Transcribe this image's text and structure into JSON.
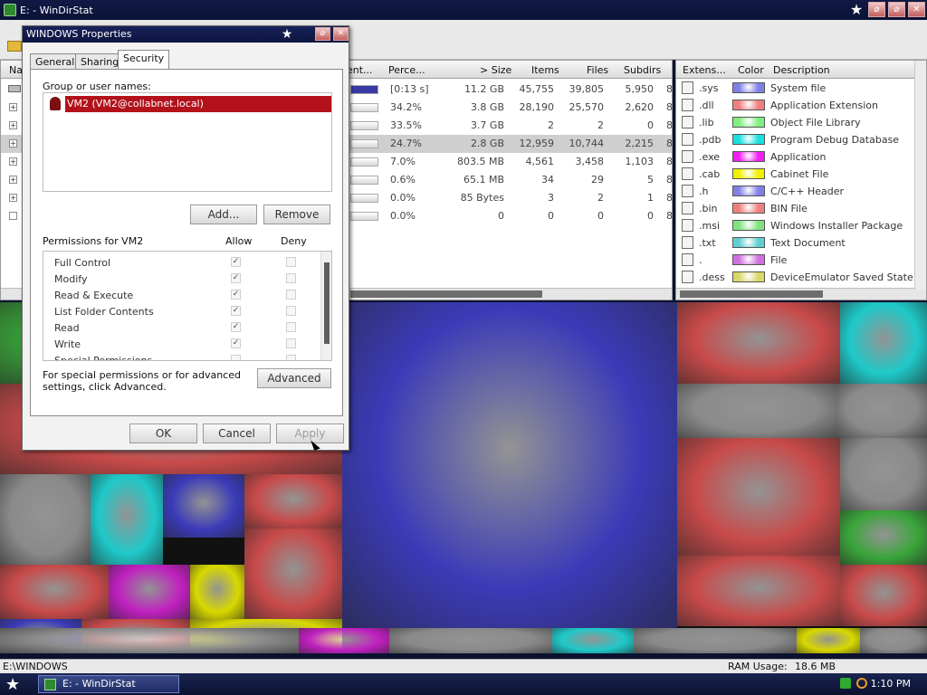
{
  "window": {
    "title": "E: - WinDirStat"
  },
  "list": {
    "headers": {
      "name": "Na",
      "subtree": "ent...",
      "percent": "Perce...",
      "size": "> Size",
      "items": "Items",
      "files": "Files",
      "subdirs": "Subdirs"
    },
    "rows": [
      {
        "percent": "[0:13 s]",
        "size": "11.2 GB",
        "items": "45,755",
        "files": "39,805",
        "subdirs": "5,950",
        "fill": 1.0,
        "expander": ""
      },
      {
        "percent": "34.2%",
        "size": "3.8 GB",
        "items": "28,190",
        "files": "25,570",
        "subdirs": "2,620",
        "fill": 0.0,
        "expander": "+"
      },
      {
        "percent": "33.5%",
        "size": "3.7 GB",
        "items": "2",
        "files": "2",
        "subdirs": "0",
        "fill": 0.0,
        "expander": "+"
      },
      {
        "percent": "24.7%",
        "size": "2.8 GB",
        "items": "12,959",
        "files": "10,744",
        "subdirs": "2,215",
        "fill": 0.0,
        "expander": "+"
      },
      {
        "percent": "7.0%",
        "size": "803.5 MB",
        "items": "4,561",
        "files": "3,458",
        "subdirs": "1,103",
        "fill": 0.0,
        "expander": "+"
      },
      {
        "percent": "0.6%",
        "size": "65.1 MB",
        "items": "34",
        "files": "29",
        "subdirs": "5",
        "fill": 0.0,
        "expander": "+"
      },
      {
        "percent": "0.0%",
        "size": "85 Bytes",
        "items": "3",
        "files": "2",
        "subdirs": "1",
        "fill": 0.0,
        "expander": "+"
      },
      {
        "percent": "0.0%",
        "size": "0",
        "items": "0",
        "files": "0",
        "subdirs": "0",
        "fill": 0.0,
        "expander": ""
      }
    ],
    "trailing_digit": "8",
    "selected_row_index": 3
  },
  "extensions": {
    "headers": {
      "ext": "Extens...",
      "color": "Color",
      "desc": "Description"
    },
    "rows": [
      {
        "ext": ".sys",
        "color": "#7f7fe6",
        "desc": "System file"
      },
      {
        "ext": ".dll",
        "color": "#ef7f7f",
        "desc": "Application Extension"
      },
      {
        "ext": ".lib",
        "color": "#7fef7f",
        "desc": "Object File Library"
      },
      {
        "ext": ".pdb",
        "color": "#19e0e0",
        "desc": "Program Debug Database"
      },
      {
        "ext": ".exe",
        "color": "#f01ff0",
        "desc": "Application"
      },
      {
        "ext": ".cab",
        "color": "#f0f000",
        "desc": "Cabinet File"
      },
      {
        "ext": ".h",
        "color": "#8080e6",
        "desc": "C/C++ Header"
      },
      {
        "ext": ".bin",
        "color": "#ef7f7f",
        "desc": "BIN File"
      },
      {
        "ext": ".msi",
        "color": "#7fe27f",
        "desc": "Windows Installer Package"
      },
      {
        "ext": ".txt",
        "color": "#5fcfcf",
        "desc": "Text Document"
      },
      {
        "ext": ".",
        "color": "#d070e0",
        "desc": "File"
      },
      {
        "ext": ".dess",
        "color": "#d8d86a",
        "desc": "DeviceEmulator Saved State File"
      }
    ]
  },
  "dialog": {
    "title": "WINDOWS Properties",
    "tabs": [
      "General",
      "Sharing",
      "Security"
    ],
    "active_tab": "Security",
    "group_label": "Group or user names:",
    "selected_user": "VM2 (VM2@collabnet.local)",
    "add_button": "Add...",
    "remove_button": "Remove",
    "permissions_label": "Permissions for VM2",
    "allow_label": "Allow",
    "deny_label": "Deny",
    "permissions": [
      {
        "name": "Full Control",
        "allow": true,
        "deny": false
      },
      {
        "name": "Modify",
        "allow": true,
        "deny": false
      },
      {
        "name": "Read & Execute",
        "allow": true,
        "deny": false
      },
      {
        "name": "List Folder Contents",
        "allow": true,
        "deny": false
      },
      {
        "name": "Read",
        "allow": true,
        "deny": false
      },
      {
        "name": "Write",
        "allow": true,
        "deny": false
      },
      {
        "name": "Special Permissions",
        "allow": false,
        "deny": false
      }
    ],
    "advanced_text": "For special permissions or for advanced settings, click Advanced.",
    "advanced_button": "Advanced",
    "ok_button": "OK",
    "cancel_button": "Cancel",
    "apply_button": "Apply"
  },
  "status": {
    "path": "E:\\WINDOWS",
    "ram_label": "RAM Usage:",
    "ram_value": "18.6 MB"
  },
  "taskbar": {
    "item": "E: - WinDirStat",
    "clock": "1:10 PM"
  },
  "treemap_colors": {
    "blue": "#3b3bb8",
    "red": "#c84a4a",
    "gray": "#8a8a8a",
    "cyan": "#1fc9c9",
    "magenta": "#c020c0",
    "yellow": "#d8d800",
    "green": "#3aa53a"
  }
}
